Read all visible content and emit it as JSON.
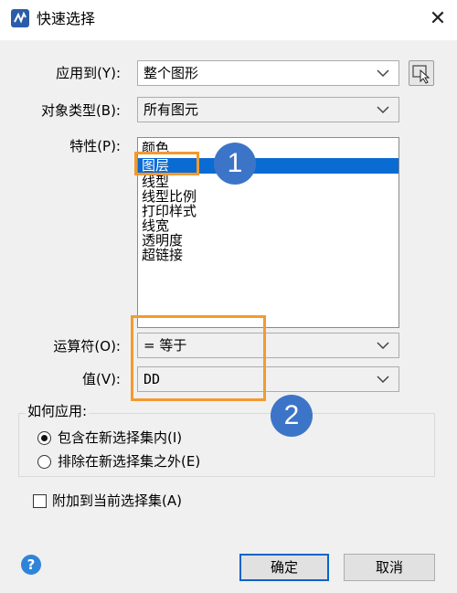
{
  "window": {
    "title": "快速选择",
    "close_glyph": "✕"
  },
  "fields": {
    "apply_to": {
      "label": "应用到(Y):",
      "value": "整个图形"
    },
    "object_type": {
      "label": "对象类型(B):",
      "value": "所有图元"
    },
    "properties": {
      "label": "特性(P):",
      "items": [
        "颜色",
        "图层",
        "线型",
        "线型比例",
        "打印样式",
        "线宽",
        "透明度",
        "超链接"
      ],
      "selected": "图层"
    },
    "operator": {
      "label": "运算符(O):",
      "value": "= 等于"
    },
    "value": {
      "label": "值(V):",
      "value": "DD"
    }
  },
  "how_to_apply": {
    "label": "如何应用:",
    "options": [
      {
        "label": "包含在新选择集内(I)",
        "checked": true
      },
      {
        "label": "排除在新选择集之外(E)",
        "checked": false
      }
    ]
  },
  "append": {
    "label": "附加到当前选择集(A)",
    "checked": false
  },
  "buttons": {
    "help": "?",
    "ok": "确定",
    "cancel": "取消"
  },
  "annotations": {
    "badge_1": "1",
    "badge_2": "2",
    "highlight_color": "#f39a2f",
    "badge_color": "#3c75c8"
  },
  "colors": {
    "selection": "#0a6bd3",
    "dialog_bg": "#f0f0f0",
    "default_button_border": "#0a64c8"
  }
}
